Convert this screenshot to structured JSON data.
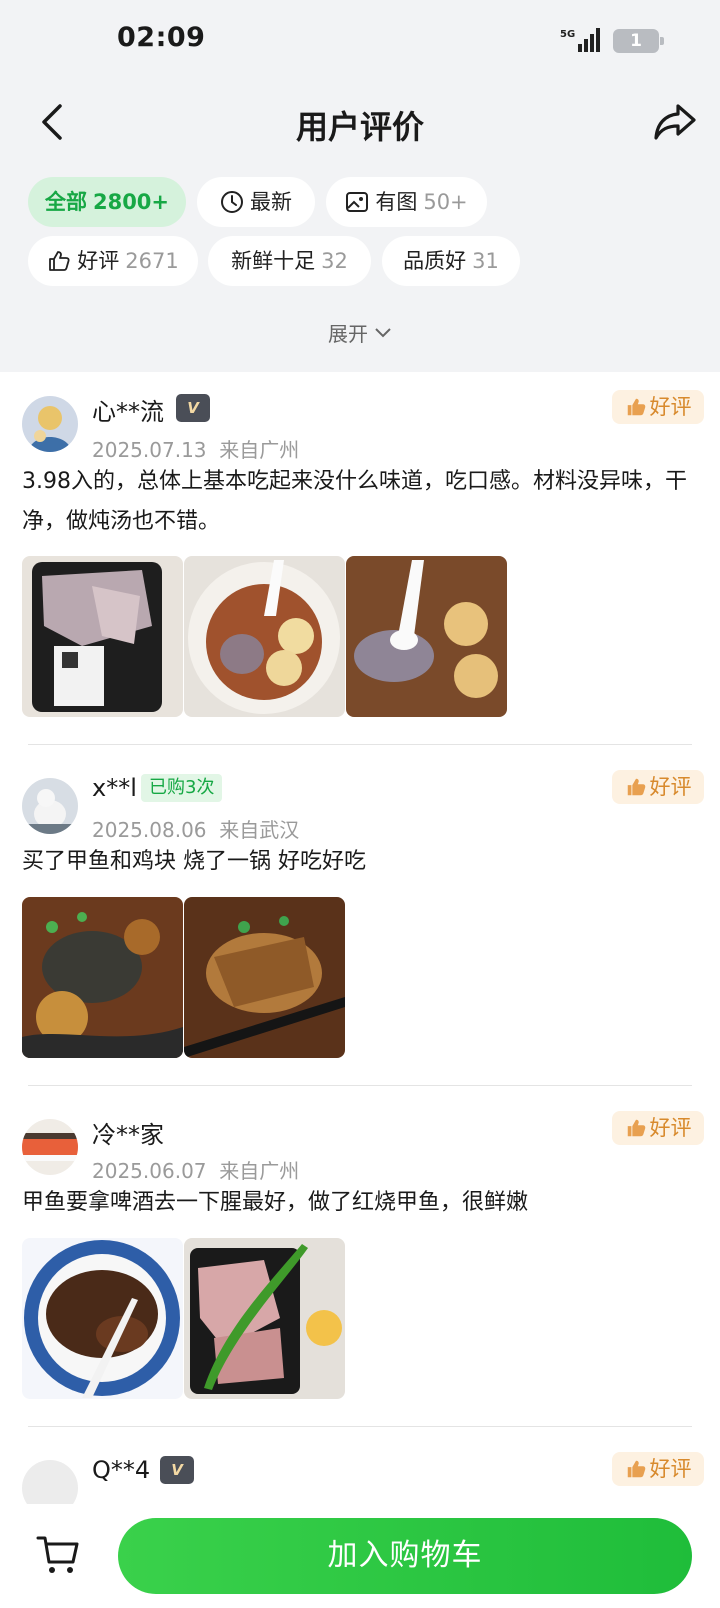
{
  "status_bar": {
    "time": "02:09",
    "network": "5G",
    "battery": "1"
  },
  "header": {
    "title": "用户评价"
  },
  "filters": {
    "all": {
      "label": "全部",
      "count": "2800+"
    },
    "latest": {
      "label": "最新"
    },
    "with_photo": {
      "label": "有图",
      "count": "50+"
    },
    "positive": {
      "label": "好评",
      "count": "2671"
    },
    "fresh": {
      "label": "新鲜十足",
      "count": "32"
    },
    "quality": {
      "label": "品质好",
      "count": "31"
    },
    "expand_label": "展开"
  },
  "reviews": [
    {
      "user": "心**流",
      "vip_badge": "V",
      "rating_badge": "好评",
      "date": "2025.07.13",
      "location": "来自广州",
      "text": "3.98入的，总体上基本吃起来没什么味道，吃口感。材料没异味，干净，做炖汤也不错。",
      "photo_count": 3
    },
    {
      "user": "x**l",
      "purchase_badge": "已购3次",
      "rating_badge": "好评",
      "date": "2025.08.06",
      "location": "来自武汉",
      "text": "买了甲鱼和鸡块 烧了一锅 好吃好吃",
      "photo_count": 2
    },
    {
      "user": "冷**家",
      "rating_badge": "好评",
      "date": "2025.06.07",
      "location": "来自广州",
      "text": "甲鱼要拿啤酒去一下腥最好，做了红烧甲鱼，很鲜嫩",
      "photo_count": 2
    },
    {
      "user": "Q**4",
      "vip_badge": "V",
      "rating_badge": "好评"
    }
  ],
  "bottom_bar": {
    "add_to_cart_label": "加入购物车"
  },
  "colors": {
    "accent_green": "#1fbd3a",
    "good_orange": "#d88a2d",
    "chip_active_bg": "#d5f2dc"
  }
}
